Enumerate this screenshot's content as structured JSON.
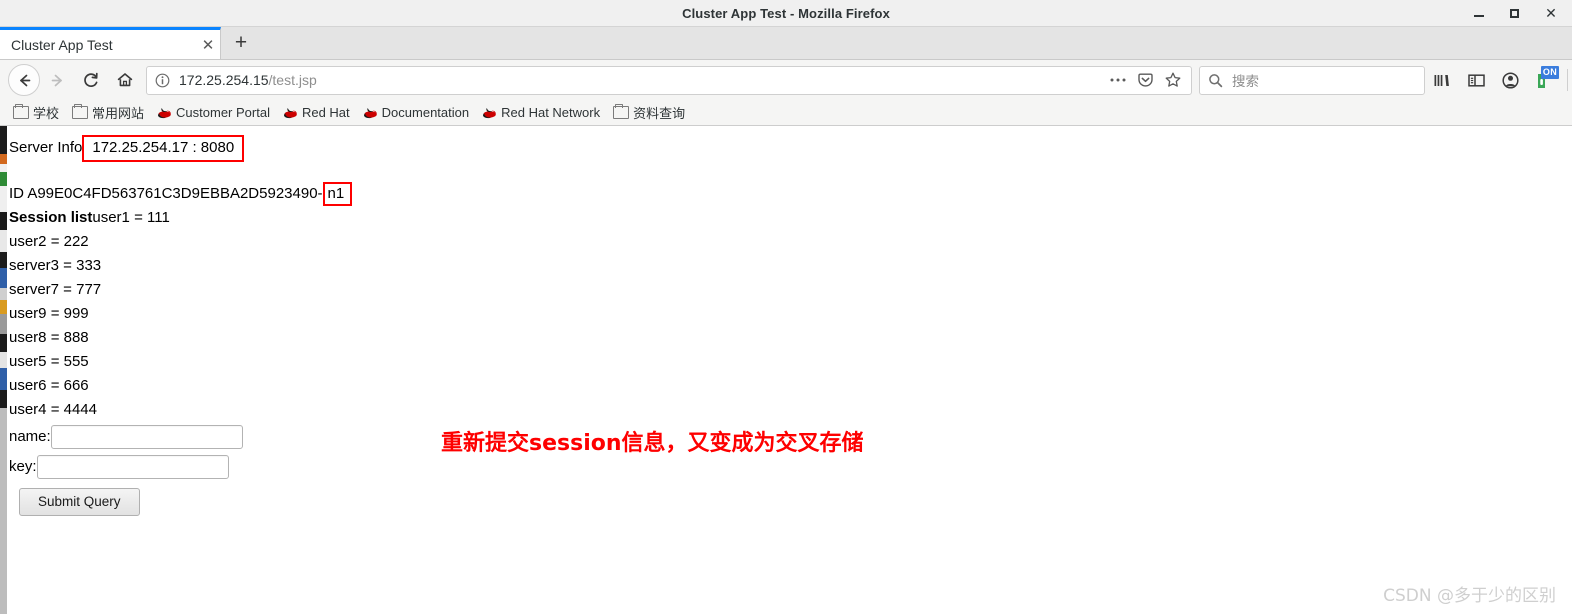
{
  "window": {
    "title": "Cluster App Test - Mozilla Firefox",
    "controls": {
      "minimize": "minimize-button",
      "maximize": "maximize-button",
      "close_glyph": "✕"
    }
  },
  "tabs": [
    {
      "label": "Cluster App Test",
      "close_glyph": "✕",
      "active": true
    }
  ],
  "newtab_label": "+",
  "nav": {
    "back_glyph": "←",
    "forward_glyph": "→",
    "reload_glyph": "↻",
    "home_glyph": "⌂"
  },
  "urlbar": {
    "host": "172.25.254.15",
    "path": "/test.jsp",
    "info_icon": "identity-info-icon",
    "page_actions_glyph": "•••",
    "pocket_icon": "pocket-icon",
    "bookmark_star_glyph": "☆"
  },
  "search": {
    "placeholder": "搜索",
    "icon": "search-icon"
  },
  "toolbar_right": {
    "library_icon": "library-icon",
    "sidebar_icon": "sidebar-icon",
    "account_icon": "account-icon",
    "extension_icon": "extension-icon",
    "extension_badge": "ON",
    "extension_badge_color": "#3b7ddd",
    "menu_glyph": "☰"
  },
  "bookmarks": [
    {
      "label": "学校",
      "icon": "folder-icon"
    },
    {
      "label": "常用网站",
      "icon": "folder-icon"
    },
    {
      "label": "Customer Portal",
      "icon": "redhat-icon"
    },
    {
      "label": "Red Hat",
      "icon": "redhat-icon"
    },
    {
      "label": "Documentation",
      "icon": "redhat-icon"
    },
    {
      "label": "Red Hat Network",
      "icon": "redhat-icon"
    },
    {
      "label": "资料查询",
      "icon": "folder-icon"
    }
  ],
  "page": {
    "server_info_label": "Server Info",
    "server_info_value": "172.25.254.17 : 8080",
    "id_prefix": "ID A99E0C4FD563761C3D9EBBA2D5923490-",
    "id_suffix": "n1",
    "session_list_label": "Session list",
    "sessions": [
      {
        "key": "user1",
        "value": "111",
        "text": "user1 = 111"
      },
      {
        "key": "user2",
        "value": "222",
        "text": "user2 = 222"
      },
      {
        "key": "server3",
        "value": "333",
        "text": "server3 = 333"
      },
      {
        "key": "server7",
        "value": "777",
        "text": "server7 = 777"
      },
      {
        "key": "user9",
        "value": "999",
        "text": "user9 = 999"
      },
      {
        "key": "user8",
        "value": "888",
        "text": "user8 = 888"
      },
      {
        "key": "user5",
        "value": "555",
        "text": "user5 = 555"
      },
      {
        "key": "user6",
        "value": "666",
        "text": "user6 = 666"
      },
      {
        "key": "user4",
        "value": "4444",
        "text": "user4 = 4444"
      }
    ],
    "form": {
      "name_label": "name:",
      "name_value": "",
      "key_label": "key:",
      "key_value": "",
      "submit_label": "Submit Query"
    },
    "annotation": "重新提交session信息，又变成为交叉存储",
    "annotation_color": "#fe0000",
    "highlight_color": "#fe0000",
    "watermark": "CSDN @多于少的区别"
  }
}
